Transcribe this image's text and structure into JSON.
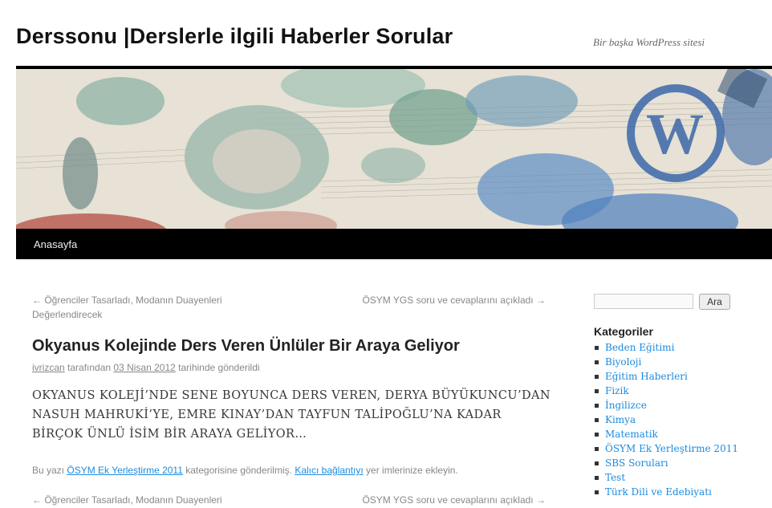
{
  "site": {
    "title": "Derssonu |Derslerle ilgili Haberler Sorular",
    "description": "Bir başka WordPress sitesi"
  },
  "nav": {
    "home_label": "Anasayfa"
  },
  "post_nav_top": {
    "prev_arrow": "←",
    "prev_label": "Öğrenciler Tasarladı, Modanın Duayenleri Değerlendirecek",
    "next_label": "ÖSYM YGS soru ve cevaplarını açıkladı",
    "next_arrow": "→"
  },
  "post": {
    "title": "Okyanus Kolejinde Ders Veren Ünlüler Bir Araya Geliyor",
    "author": "ivrizcan",
    "by_text": "tarafından",
    "date": "03 Nisan 2012",
    "posted_text": "tarihinde gönderildi",
    "summary": "OKYANUS KOLEJİ’NDE SENE BOYUNCA DERS VEREN, DERYA BÜYÜKUNCU’DAN NASUH MAHRUKİ’YE, EMRE KINAY’DAN TAYFUN TALİPOĞLU’NA KADAR BİRÇOK ÜNLÜ İSİM BİR ARAYA GELİYOR…",
    "footer_prefix": "Bu yazı",
    "category": "ÖSYM Ek Yerleştirme 2011",
    "footer_middle": "kategorisine gönderilmiş.",
    "permalink_label": "Kalıcı bağlantıyı",
    "footer_suffix": "yer imlerinize ekleyin."
  },
  "post_nav_bottom": {
    "prev_arrow": "←",
    "prev_label": "Öğrenciler Tasarladı, Modanın Duayenleri",
    "next_label": "ÖSYM YGS soru ve cevaplarını açıkladı",
    "next_arrow": "→"
  },
  "sidebar": {
    "search_placeholder": "",
    "search_button": "Ara",
    "categories_title": "Kategoriler",
    "categories": [
      "Beden Eğitimi",
      "Biyoloji",
      "Eğitim Haberleri",
      "Fizik",
      "İngilizce",
      "Kimya",
      "Matematik",
      "ÖSYM Ek Yerleştirme 2011",
      "SBS Soruları",
      "Test",
      "Türk Dili ve Edebiyatı"
    ]
  },
  "colors": {
    "link": "#1b8be0",
    "nav_bg": "#000000",
    "header_rule": "#000000"
  }
}
